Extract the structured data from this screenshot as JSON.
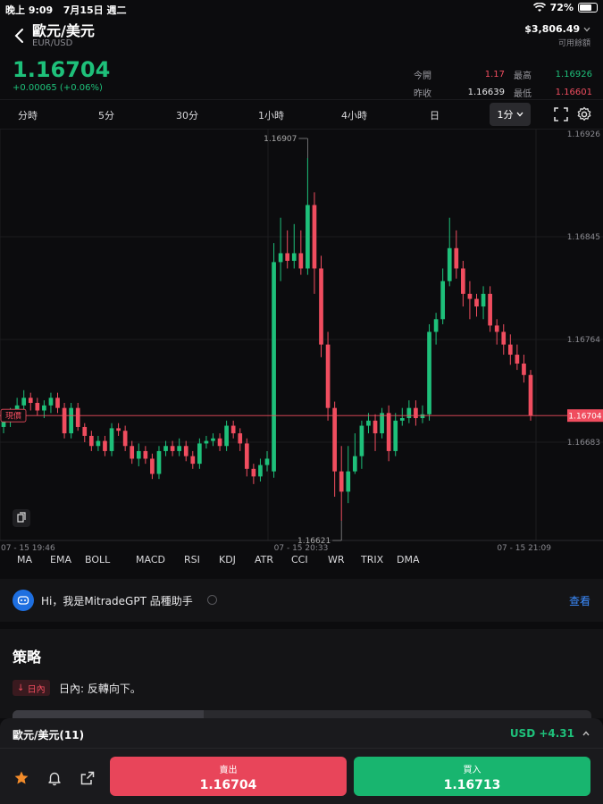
{
  "status_bar": {
    "time": "晚上 9:09",
    "date": "7月15日 週二",
    "battery": "72%",
    "battery_level": 0.72
  },
  "header": {
    "title": "歐元/美元",
    "symbol": "EUR/USD",
    "balance": "$3,806.49",
    "balance_label": "可用餘額"
  },
  "quote": {
    "price": "1.16704",
    "change": "+0.00065 (+0.06%)",
    "open_label": "今開",
    "open": "1.17",
    "high_label": "最高",
    "high": "1.16926",
    "prev_close_label": "昨收",
    "prev_close": "1.16639",
    "low_label": "最低",
    "low": "1.16601"
  },
  "timeframes": [
    "分時",
    "5分",
    "30分",
    "1小時",
    "4小時",
    "日"
  ],
  "selected_timeframe": "1分",
  "chart_data": {
    "type": "candlestick",
    "y_ticks": [
      "1.16926",
      "1.16845",
      "1.16764",
      "1.16683"
    ],
    "current_price_tag": "現價",
    "current_price": "1.16704",
    "max_marker": "1.16907",
    "min_marker": "1.16621",
    "x_labels": [
      "07 - 15 19:46",
      "07 - 15 20:33",
      "07 - 15 21:09"
    ],
    "candles": [
      [
        1.16695,
        1.167,
        1.16705,
        1.1669
      ],
      [
        1.167,
        1.16705,
        1.1671,
        1.16695
      ],
      [
        1.16705,
        1.16712,
        1.16718,
        1.167
      ],
      [
        1.16712,
        1.16718,
        1.16724,
        1.16708
      ],
      [
        1.16718,
        1.16714,
        1.16722,
        1.16708
      ],
      [
        1.16714,
        1.16708,
        1.16718,
        1.16704
      ],
      [
        1.16708,
        1.16712,
        1.16716,
        1.16702
      ],
      [
        1.16712,
        1.16718,
        1.16722,
        1.16706
      ],
      [
        1.16718,
        1.1671,
        1.16722,
        1.16706
      ],
      [
        1.1671,
        1.1669,
        1.16714,
        1.16686
      ],
      [
        1.1669,
        1.1671,
        1.16714,
        1.16686
      ],
      [
        1.1671,
        1.16695,
        1.16714,
        1.16692
      ],
      [
        1.16695,
        1.16688,
        1.16698,
        1.16683
      ],
      [
        1.16688,
        1.1668,
        1.16692,
        1.16676
      ],
      [
        1.1668,
        1.16684,
        1.16688,
        1.16676
      ],
      [
        1.16684,
        1.16676,
        1.16688,
        1.16672
      ],
      [
        1.16676,
        1.16694,
        1.16698,
        1.16672
      ],
      [
        1.16694,
        1.16692,
        1.16698,
        1.16688
      ],
      [
        1.16692,
        1.1668,
        1.16696,
        1.16676
      ],
      [
        1.1668,
        1.1667,
        1.16684,
        1.16666
      ],
      [
        1.1667,
        1.16676,
        1.16682,
        1.16664
      ],
      [
        1.16676,
        1.1667,
        1.1668,
        1.16666
      ],
      [
        1.1667,
        1.16658,
        1.16674,
        1.16654
      ],
      [
        1.16658,
        1.16676,
        1.1668,
        1.16654
      ],
      [
        1.16676,
        1.1668,
        1.16684,
        1.16672
      ],
      [
        1.1668,
        1.16676,
        1.16684,
        1.16672
      ],
      [
        1.16676,
        1.1668,
        1.16686,
        1.16672
      ],
      [
        1.1668,
        1.16672,
        1.16684,
        1.16668
      ],
      [
        1.16672,
        1.16666,
        1.16676,
        1.16662
      ],
      [
        1.16666,
        1.16682,
        1.16686,
        1.16662
      ],
      [
        1.16682,
        1.16684,
        1.16688,
        1.16678
      ],
      [
        1.16684,
        1.16686,
        1.1669,
        1.1668
      ],
      [
        1.16686,
        1.1668,
        1.1669,
        1.16676
      ],
      [
        1.1668,
        1.16696,
        1.167,
        1.16676
      ],
      [
        1.16696,
        1.1669,
        1.167,
        1.16686
      ],
      [
        1.1669,
        1.16682,
        1.16694,
        1.16676
      ],
      [
        1.16682,
        1.16662,
        1.16686,
        1.16656
      ],
      [
        1.16662,
        1.16656,
        1.16666,
        1.1665
      ],
      [
        1.16656,
        1.16665,
        1.1667,
        1.16652
      ],
      [
        1.16665,
        1.1667,
        1.16676,
        1.1666
      ],
      [
        1.1666,
        1.16825,
        1.1684,
        1.16655
      ],
      [
        1.16825,
        1.16832,
        1.1686,
        1.1681
      ],
      [
        1.16832,
        1.16826,
        1.1685,
        1.1682
      ],
      [
        1.16826,
        1.16832,
        1.16855,
        1.1682
      ],
      [
        1.16832,
        1.1682,
        1.1685,
        1.16815
      ],
      [
        1.1682,
        1.1687,
        1.16907,
        1.16815
      ],
      [
        1.1687,
        1.1682,
        1.1688,
        1.168
      ],
      [
        1.1682,
        1.1676,
        1.1683,
        1.1675
      ],
      [
        1.1676,
        1.1671,
        1.1677,
        1.167
      ],
      [
        1.1671,
        1.1666,
        1.16715,
        1.1664
      ],
      [
        1.1666,
        1.16644,
        1.1668,
        1.16621
      ],
      [
        1.16644,
        1.1666,
        1.1668,
        1.16635
      ],
      [
        1.1666,
        1.16672,
        1.1669,
        1.16658
      ],
      [
        1.16672,
        1.16696,
        1.167,
        1.16662
      ],
      [
        1.16696,
        1.167,
        1.16706,
        1.1669
      ],
      [
        1.167,
        1.1669,
        1.16705,
        1.16676
      ],
      [
        1.1669,
        1.16706,
        1.1671,
        1.16686
      ],
      [
        1.16706,
        1.16676,
        1.16712,
        1.16668
      ],
      [
        1.16676,
        1.167,
        1.16706,
        1.16672
      ],
      [
        1.167,
        1.16702,
        1.1671,
        1.16696
      ],
      [
        1.16702,
        1.1671,
        1.16716,
        1.16698
      ],
      [
        1.1671,
        1.16702,
        1.16716,
        1.16696
      ],
      [
        1.16702,
        1.16705,
        1.16712,
        1.16698
      ],
      [
        1.16705,
        1.1677,
        1.16776,
        1.167
      ],
      [
        1.1677,
        1.1678,
        1.16785,
        1.1676
      ],
      [
        1.1678,
        1.1681,
        1.1682,
        1.16776
      ],
      [
        1.1681,
        1.16836,
        1.1686,
        1.16806
      ],
      [
        1.16836,
        1.1682,
        1.1685,
        1.16812
      ],
      [
        1.1682,
        1.168,
        1.16826,
        1.1679
      ],
      [
        1.168,
        1.16796,
        1.1681,
        1.1678
      ],
      [
        1.16796,
        1.1679,
        1.168,
        1.16782
      ],
      [
        1.1679,
        1.168,
        1.16806,
        1.1678
      ],
      [
        1.168,
        1.16775,
        1.16806,
        1.1677
      ],
      [
        1.16775,
        1.1677,
        1.1678,
        1.1676
      ],
      [
        1.1677,
        1.1676,
        1.16776,
        1.16752
      ],
      [
        1.1676,
        1.16752,
        1.16768,
        1.16744
      ],
      [
        1.16752,
        1.16745,
        1.1676,
        1.1674
      ],
      [
        1.16745,
        1.16736,
        1.16752,
        1.1673
      ],
      [
        1.16736,
        1.16704,
        1.1674,
        1.167
      ]
    ]
  },
  "indicators": [
    "MA",
    "EMA",
    "BOLL",
    "MACD",
    "RSI",
    "KDJ",
    "ATR",
    "CCI",
    "WR",
    "TRIX",
    "DMA"
  ],
  "gpt": {
    "message": "Hi，我是MitradeGPT 品種助手",
    "action": "查看"
  },
  "strategy": {
    "heading": "策略",
    "tag": "日內",
    "text": "日內: 反轉向下。"
  },
  "position": {
    "name": "歐元/美元(11)",
    "pl": "USD +4.31"
  },
  "trade": {
    "sell_label": "賣出",
    "sell_price": "1.16704",
    "buy_label": "買入",
    "buy_price": "1.16713"
  },
  "colors": {
    "up": "#1ec07a",
    "down": "#f04d5f",
    "accent": "#3b8cff"
  }
}
